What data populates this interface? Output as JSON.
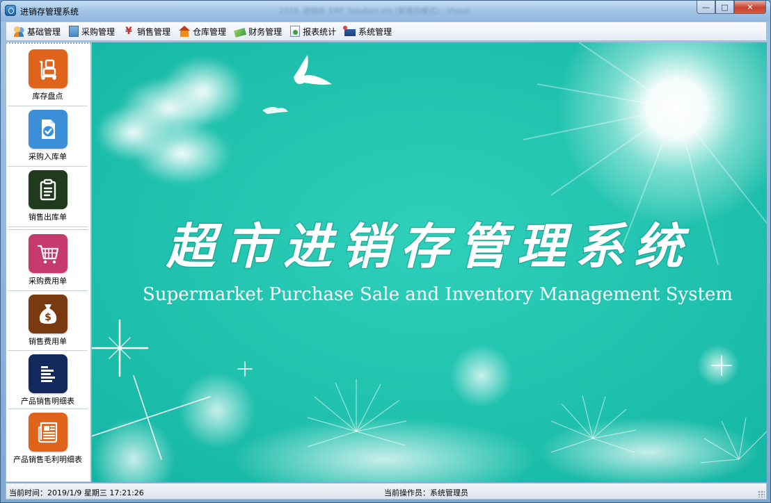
{
  "window": {
    "title": "进销存管理系统",
    "title_extra": "2019_进销存_ERP_Solution.sln (管理员模式) - Visual",
    "controls": {
      "minimize": "—",
      "maximize": "□",
      "close": "✕"
    }
  },
  "menubar": {
    "items": [
      {
        "label": "基础管理",
        "icon": "users-icon"
      },
      {
        "label": "采购管理",
        "icon": "building-icon"
      },
      {
        "label": "销售管理",
        "icon": "sale-icon"
      },
      {
        "label": "仓库管理",
        "icon": "warehouse-icon"
      },
      {
        "label": "财务管理",
        "icon": "money-icon"
      },
      {
        "label": "报表统计",
        "icon": "report-icon"
      },
      {
        "label": "系统管理",
        "icon": "system-icon"
      }
    ]
  },
  "sidebar": {
    "items": [
      {
        "label": "库存盘点",
        "icon": "inventory-icon",
        "color": "#e0631c"
      },
      {
        "label": "采购入库单",
        "icon": "document-check-icon",
        "color": "#3a8fd8"
      },
      {
        "label": "销售出库单",
        "icon": "clipboard-icon",
        "color": "#1f3a1c"
      },
      {
        "label": "采购费用单",
        "icon": "cart-icon",
        "color": "#c73a6e"
      },
      {
        "label": "销售费用单",
        "icon": "moneybag-icon",
        "color": "#7a3a10"
      },
      {
        "label": "产品销售明细表",
        "icon": "list-icon",
        "color": "#13295e"
      },
      {
        "label": "产品销售毛利明细表",
        "icon": "newspaper-icon",
        "color": "#e0631c"
      }
    ]
  },
  "hero": {
    "title_cn": "超市进销存管理系统",
    "title_en": "Supermarket Purchase  Sale and Inventory Management System",
    "background": "#1fc4b0"
  },
  "status": {
    "time": "当前时间：2019/1/9 星期三 17:21:26",
    "operator": "当前操作员：系统管理员"
  }
}
